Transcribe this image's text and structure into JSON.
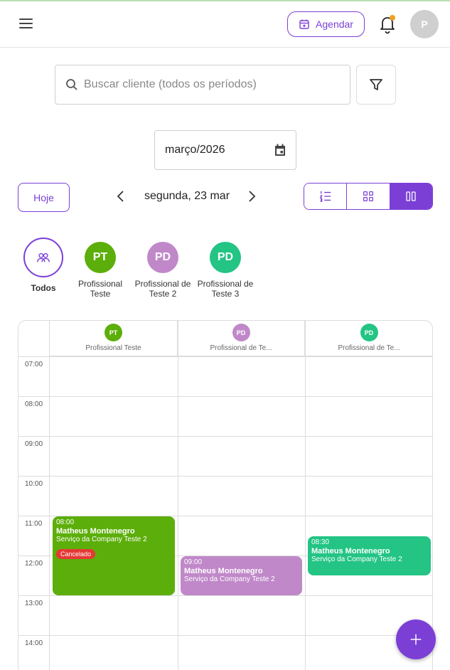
{
  "header": {
    "agendar_label": "Agendar",
    "avatar_initial": "P",
    "accent": "#7b3fd6",
    "notification_dot_color": "#f0a020"
  },
  "search": {
    "placeholder": "Buscar cliente (todos os períodos)",
    "value": ""
  },
  "date_picker": {
    "value": "março/2026"
  },
  "nav": {
    "today_label": "Hoje",
    "current_day": "segunda, 23 mar",
    "views": [
      "list",
      "grid",
      "columns"
    ],
    "active_view": "columns"
  },
  "professionals": [
    {
      "initials": "",
      "name": "Todos",
      "color": "#7b3fd6",
      "selected": true
    },
    {
      "initials": "PT",
      "name": "Profissional Teste",
      "color": "#5cae0a"
    },
    {
      "initials": "PD",
      "name": "Profissional de Teste 2",
      "color": "#c088c9"
    },
    {
      "initials": "PD",
      "name": "Profissional de Teste 3",
      "color": "#23c484"
    }
  ],
  "calendar": {
    "columns": [
      {
        "initials": "PT",
        "name": "Profissional Teste",
        "color": "#5cae0a"
      },
      {
        "initials": "PD",
        "name": "Profissional de Te...",
        "color": "#c088c9"
      },
      {
        "initials": "PD",
        "name": "Profissional de Te...",
        "color": "#23c484"
      }
    ],
    "hours": [
      "07:00",
      "08:00",
      "09:00",
      "10:00",
      "11:00",
      "12:00",
      "13:00",
      "14:00"
    ],
    "events": [
      {
        "column": 0,
        "time": "08:00",
        "client": "Matheus Montenegro",
        "service": "Serviço da Company Teste 2",
        "status": "Cancelado",
        "color": "#5cae0a"
      },
      {
        "column": 1,
        "time": "09:00",
        "client": "Matheus Montenegro",
        "service": "Serviço da Company Teste 2",
        "status": "",
        "color": "#c088c9"
      },
      {
        "column": 2,
        "time": "08:30",
        "client": "Matheus Montenegro",
        "service": "Serviço da Company Teste 2",
        "status": "",
        "color": "#23c484"
      }
    ]
  }
}
